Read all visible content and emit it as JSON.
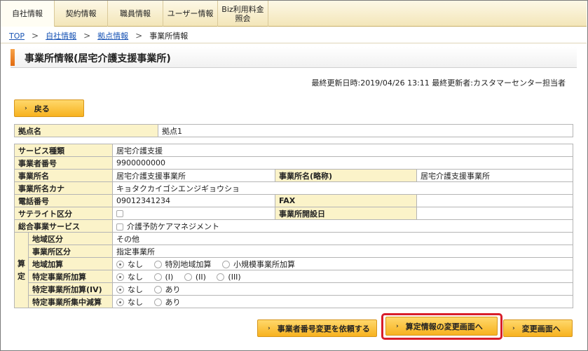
{
  "nav": {
    "tabs": [
      "自社情報",
      "契約情報",
      "職員情報",
      "ユーザー情報",
      "Biz利用料金\n照会"
    ]
  },
  "breadcrumb": {
    "top": "TOP",
    "company": "自社情報",
    "base": "拠点情報",
    "current": "事業所情報"
  },
  "page_title": "事業所情報(居宅介護支援事業所)",
  "update_info": "最終更新日時:2019/04/26 13:11 最終更新者:カスタマーセンター担当者",
  "back_button": "戻る",
  "base": {
    "label": "拠点名",
    "value": "拠点1"
  },
  "service": {
    "service_type_label": "サービス種類",
    "service_type": "居宅介護支援",
    "provider_no_label": "事業者番号",
    "provider_no": "9900000000",
    "office_name_label": "事業所名",
    "office_name": "居宅介護支援事業所",
    "office_short_label": "事業所名(略称)",
    "office_short": "居宅介護支援事業所",
    "office_kana_label": "事業所名カナ",
    "office_kana": "キョタクカイゴシエンジギョウショ",
    "phone_label": "電話番号",
    "phone": "09012341234",
    "fax_label": "FAX",
    "fax": "",
    "satellite_label": "サテライト区分",
    "open_date_label": "事業所開設日",
    "open_date": "",
    "comprehensive_label": "総合事業サービス",
    "comprehensive_option": "介護予防ケアマネジメント"
  },
  "santei": {
    "label": "算\n定",
    "region_label": "地域区分",
    "region": "その他",
    "office_class_label": "事業所区分",
    "office_class": "指定事業所",
    "region_add_label": "地域加算",
    "region_add_options": [
      "なし",
      "特別地域加算",
      "小規模事業所加算"
    ],
    "special_add_label": "特定事業所加算",
    "special_add_options": [
      "なし",
      "(I)",
      "(II)",
      "(III)"
    ],
    "special_add4_label": "特定事業所加算(IV)",
    "special_add4_options": [
      "なし",
      "あり"
    ],
    "concentration_label": "特定事業所集中減算",
    "concentration_options": [
      "なし",
      "あり"
    ]
  },
  "buttons": {
    "request": "事業者番号変更を依頼する",
    "santei_change": "算定情報の変更画面へ",
    "change": "変更画面へ"
  }
}
